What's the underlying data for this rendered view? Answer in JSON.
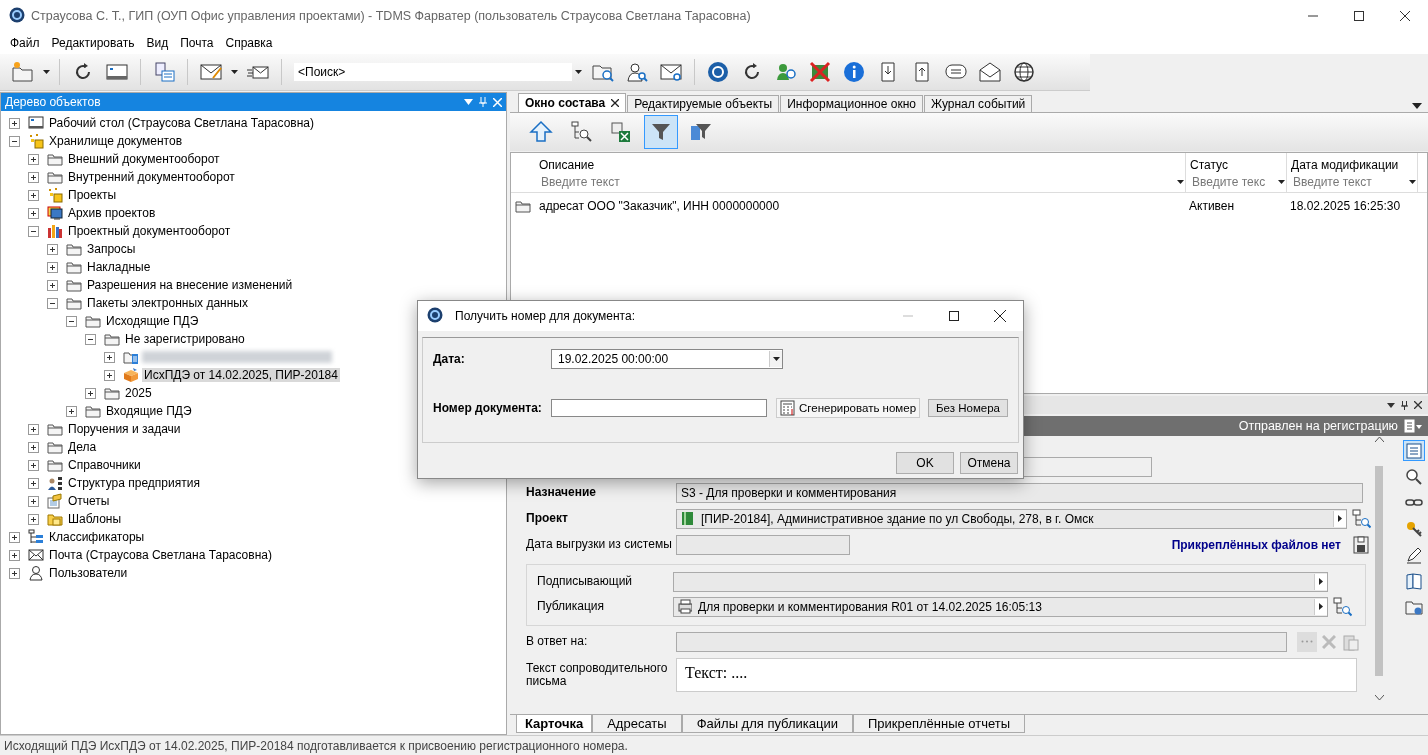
{
  "window": {
    "title": "Страусова С. Т., ГИП (ОУП Офис управления проектами) - TDMS Фарватер (пользователь Страусова Светлана Тарасовна)"
  },
  "menu": [
    "Файл",
    "Редактировать",
    "Вид",
    "Почта",
    "Справка"
  ],
  "toolbar": {
    "search": {
      "value": "<Поиск>"
    }
  },
  "tree_panel": {
    "title": "Дерево объектов",
    "items": [
      {
        "label": "Рабочий стол (Страусова Светлана Тарасовна)",
        "kind": "desk",
        "expanded": false,
        "selected": false
      },
      {
        "label": "Хранилище документов",
        "kind": "storage",
        "expanded": true,
        "selected": false,
        "children": [
          {
            "label": "Внешний документооборот",
            "kind": "folder",
            "expanded": false,
            "selected": false
          },
          {
            "label": "Внутренний документооборот",
            "kind": "folder",
            "expanded": false,
            "selected": false
          },
          {
            "label": "Проекты",
            "kind": "storage",
            "expanded": false,
            "selected": false
          },
          {
            "label": "Архив проектов",
            "kind": "archive",
            "expanded": false,
            "selected": false
          },
          {
            "label": "Проектный документооборот",
            "kind": "books",
            "expanded": true,
            "selected": false,
            "children": [
              {
                "label": "Запросы",
                "kind": "folder",
                "expanded": false,
                "selected": false
              },
              {
                "label": "Накладные",
                "kind": "folder",
                "expanded": false,
                "selected": false
              },
              {
                "label": "Разрешения на внесение изменений",
                "kind": "folder",
                "expanded": false,
                "selected": false
              },
              {
                "label": "Пакеты электронных данных",
                "kind": "folder",
                "expanded": true,
                "selected": false,
                "children": [
                  {
                    "label": "Исходящие ПДЭ",
                    "kind": "folder",
                    "expanded": true,
                    "selected": false,
                    "children": [
                      {
                        "label": "Не зарегистрировано",
                        "kind": "folder",
                        "expanded": true,
                        "selected": false,
                        "children": [
                          {
                            "kind": "blurred",
                            "expanded": false
                          },
                          {
                            "label": "ИсхПДЭ от 14.02.2025, ПИР-20184",
                            "kind": "package",
                            "expanded": false,
                            "selected": true
                          }
                        ]
                      },
                      {
                        "label": "2025",
                        "kind": "folder",
                        "expanded": false,
                        "selected": false
                      }
                    ]
                  },
                  {
                    "label": "Входящие ПДЭ",
                    "kind": "folder",
                    "expanded": false,
                    "selected": false
                  }
                ]
              }
            ]
          },
          {
            "label": "Поручения и задачи",
            "kind": "folder",
            "expanded": false,
            "selected": false
          },
          {
            "label": "Дела",
            "kind": "folder",
            "expanded": false,
            "selected": false
          },
          {
            "label": "Справочники",
            "kind": "folder",
            "expanded": false,
            "selected": false
          },
          {
            "label": "Структура предприятия",
            "kind": "org",
            "expanded": false,
            "selected": false
          },
          {
            "label": "Отчеты",
            "kind": "report",
            "expanded": false,
            "selected": false
          },
          {
            "label": "Шаблоны",
            "kind": "templates",
            "expanded": false,
            "selected": false
          }
        ]
      },
      {
        "label": "Классификаторы",
        "kind": "classifier",
        "expanded": false,
        "selected": false
      },
      {
        "label": "Почта (Страусова Светлана Тарасовна)",
        "kind": "mail",
        "expanded": false,
        "selected": false
      },
      {
        "label": "Пользователи",
        "kind": "user",
        "expanded": false,
        "selected": false
      }
    ]
  },
  "content_panel": {
    "tabs": [
      {
        "label": "Окно состава",
        "selected": true
      },
      {
        "label": "Редактируемые объекты",
        "selected": false
      },
      {
        "label": "Информационное окно",
        "selected": false
      },
      {
        "label": "Журнал событий",
        "selected": false
      }
    ],
    "tools": [
      {
        "kind": "up",
        "pressed": false
      },
      {
        "kind": "tree-search",
        "pressed": false
      },
      {
        "kind": "excel",
        "pressed": false
      },
      {
        "kind": "filter",
        "pressed": true
      },
      {
        "kind": "filter-settings",
        "pressed": false
      }
    ],
    "table": {
      "columns": [
        {
          "title": "Описание",
          "placeholder": "Введите текст"
        },
        {
          "title": "Статус",
          "placeholder": "Введите текс"
        },
        {
          "title": "Дата модификации",
          "placeholder": "Введите текст"
        }
      ],
      "rows": [
        {
          "cells": [
            "адресат ООО \"Заказчик\", ИНН 0000000000",
            "Активен",
            "18.02.2025 16:25:30"
          ]
        }
      ]
    }
  },
  "card_panel": {
    "status": "Отправлен на регистрацию",
    "rows": [
      {
        "kind": "field",
        "label": "Назначение",
        "bold": true,
        "value": "S3 - Для проверки и комментирования"
      },
      {
        "kind": "select",
        "label": "Проект",
        "bold": true,
        "value": "[ПИР-20184], Административное здание по ул Свободы, 278, в г. Омск",
        "pick": true
      },
      {
        "kind": "short",
        "label": "Дата выгрузки из системы",
        "bold": false,
        "link": "Прикреплённых файлов нет"
      },
      {
        "kind": "group",
        "rows": [
          {
            "kind": "select",
            "label": "Подписывающий",
            "bold": false,
            "pick": false
          },
          {
            "kind": "select",
            "label": "Публикация",
            "bold": false,
            "value": "Для проверки и комментирования R01 от 14.02.2025 16:05:13",
            "pick": true
          }
        ]
      },
      {
        "kind": "reply",
        "label": "В ответ на:",
        "bold": false
      },
      {
        "kind": "memo",
        "label": "Текст сопроводительного письма",
        "bold": false,
        "value": "Текст: ...."
      }
    ],
    "tabs": [
      {
        "label": "Карточка",
        "selected": true
      },
      {
        "label": "Адресаты",
        "selected": false
      },
      {
        "label": "Файлы для публикации",
        "selected": false
      },
      {
        "label": "Прикреплённые отчеты",
        "selected": false
      }
    ]
  },
  "dialog": {
    "title": "Получить номер для документа:",
    "date_label": "Дата:",
    "date_value": "19.02.2025 00:00:00",
    "number_label": "Номер документа:",
    "generate_button": "Сгенерировать номер",
    "no_number_button": "Без Номера",
    "ok_button": "OK",
    "cancel_button": "Отмена"
  },
  "status_bar": "Исходящий ПДЭ ИсхПДЭ от 14.02.2025, ПИР-20184 подготавливается к присвоению регистрационного номера."
}
